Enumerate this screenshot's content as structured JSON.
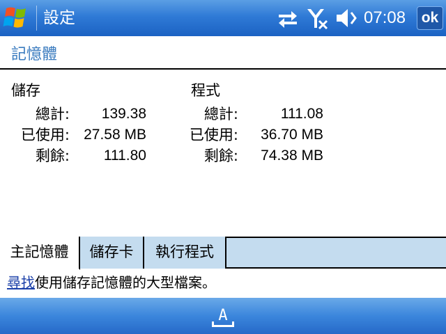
{
  "titlebar": {
    "title": "設定",
    "clock": "07:08",
    "ok_label": "ok",
    "icons": [
      "windows-start-icon",
      "connectivity-icon",
      "no-signal-icon",
      "speaker-muted-icon"
    ]
  },
  "page": {
    "heading": "記憶體"
  },
  "storage": {
    "label": "儲存",
    "rows": [
      {
        "label": "總計:",
        "value": "139.38"
      },
      {
        "label": "已使用:",
        "value": "27.58 MB"
      },
      {
        "label": "剩餘:",
        "value": "111.80"
      }
    ]
  },
  "program": {
    "label": "程式",
    "rows": [
      {
        "label": "總計:",
        "value": "111.08"
      },
      {
        "label": "已使用:",
        "value": "36.70 MB"
      },
      {
        "label": "剩餘:",
        "value": "74.38 MB"
      }
    ]
  },
  "tabs": [
    {
      "label": "主記憶體",
      "active": true
    },
    {
      "label": "儲存卡",
      "active": false
    },
    {
      "label": "執行程式",
      "active": false
    }
  ],
  "find": {
    "link": "尋找",
    "text": "使用儲存記憶體的大型檔案。"
  },
  "menubar": {
    "sip_icon": "keyboard-input-icon",
    "sip_letter": "A"
  },
  "colors": {
    "titlebar": "#2f7ad6",
    "heading": "#3a7bbf",
    "tab_strip": "#c4dcef",
    "link": "#1a3fa8"
  }
}
